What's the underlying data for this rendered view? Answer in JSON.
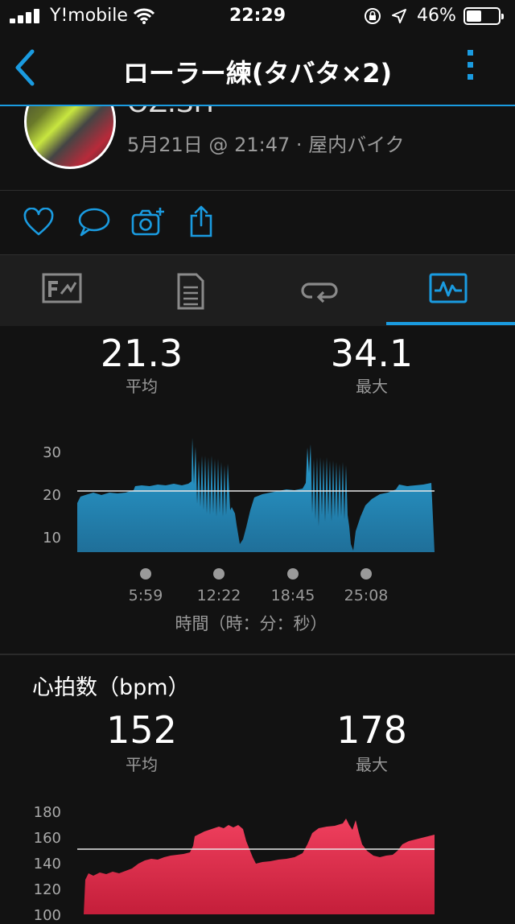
{
  "status_bar": {
    "carrier": "Y!mobile",
    "time": "22:29",
    "battery": "46%"
  },
  "nav": {
    "title": "ローラー練(タバタ×2)"
  },
  "header": {
    "user_name": "OZ.SH",
    "meta": "5月21日 @ 21:47 · 屋内バイク"
  },
  "speed": {
    "avg": "21.3",
    "avg_label": "平均",
    "max": "34.1",
    "max_label": "最大",
    "y_ticks": [
      "30",
      "20",
      "10"
    ],
    "x_ticks": [
      "5:59",
      "12:22",
      "18:45",
      "25:08"
    ],
    "x_title": "時間（時：分：秒）",
    "color": "#2aa2d6"
  },
  "heart_rate": {
    "title": "心拍数（bpm）",
    "avg": "152",
    "avg_label": "平均",
    "max": "178",
    "max_label": "最大",
    "y_ticks": [
      "180",
      "160",
      "140",
      "120",
      "100"
    ],
    "color": "#e8324f"
  },
  "colors": {
    "accent": "#1a9be0",
    "background": "#121212"
  }
}
